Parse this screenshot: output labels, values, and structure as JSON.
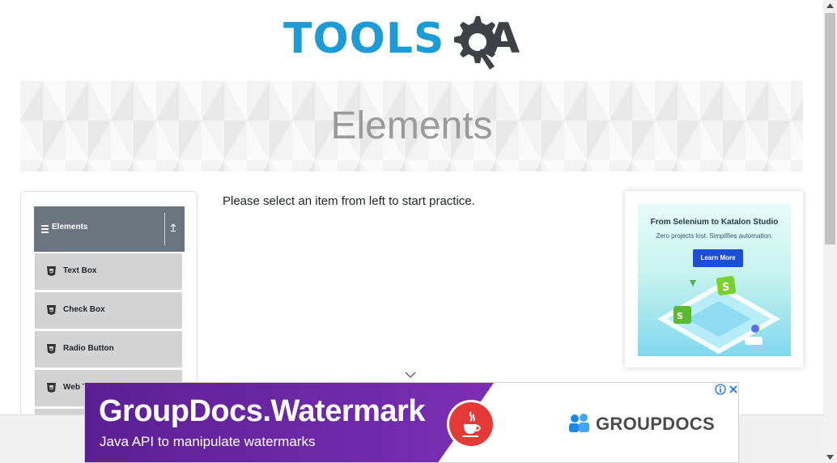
{
  "logo": {
    "part1": "TOOLS",
    "part2": "A",
    "brand": "TOOLSQA"
  },
  "banner": {
    "title": "Elements"
  },
  "sidebar": {
    "group": {
      "label": "Elements"
    },
    "items": [
      {
        "label": "Text Box"
      },
      {
        "label": "Check Box"
      },
      {
        "label": "Radio Button"
      },
      {
        "label": "Web Tables"
      }
    ]
  },
  "main": {
    "message": "Please select an item from left to start practice."
  },
  "side_ad": {
    "title": "From Selenium to Katalon Studio",
    "subtitle": "Zero projects lost. Simplifies automation.",
    "button": "Learn More"
  },
  "bottom_ad": {
    "title": "GroupDocs.Watermark",
    "subtitle": "Java API to manipulate watermarks",
    "brand": "GROUPDOCS"
  },
  "icons": {
    "menu": "hamburger-icon",
    "collapse": "arrow-up-icon",
    "item": "html5-icon",
    "chevron": "chevron-down-icon",
    "adchoices": "info-icon",
    "close": "close-icon"
  },
  "colors": {
    "brand_blue": "#1d9bd7",
    "group_header": "#6c757d",
    "menu_item": "#d3d3d3",
    "ad_purple": "#6a1b9a",
    "ad_red": "#e53935"
  }
}
